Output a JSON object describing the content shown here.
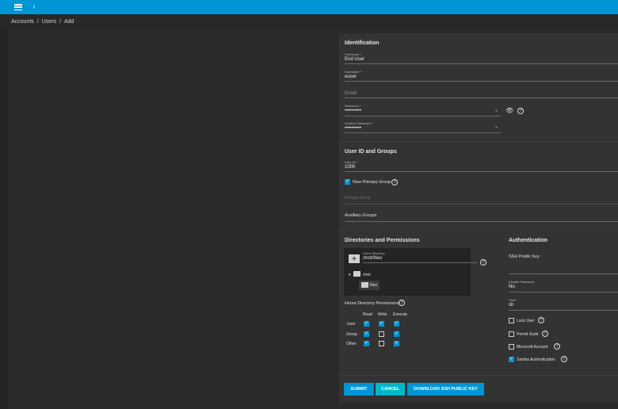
{
  "topbar": {
    "menu_icon": "hamburger-menu-icon",
    "back_icon": "chevron-left-icon"
  },
  "breadcrumb": {
    "items": [
      "Accounts",
      "/",
      "Users",
      "/",
      "Add"
    ]
  },
  "identification": {
    "title": "Identification",
    "full_name": {
      "label": "Full Name *",
      "value": "End User"
    },
    "username": {
      "label": "Username *",
      "value": "euser"
    },
    "email": {
      "placeholder": "Email"
    },
    "password": {
      "label": "Password *",
      "value": "••••••••••"
    },
    "confirm_password": {
      "label": "Confirm Password *",
      "value": "••••••••••"
    }
  },
  "user_id_groups": {
    "title": "User ID and Groups",
    "user_id": {
      "label": "User ID *",
      "value": "1000"
    },
    "new_primary_group": {
      "label": "New Primary Group",
      "checked": true
    },
    "primary_group": {
      "placeholder": "Primary Group"
    },
    "auxiliary_groups": {
      "placeholder": "Auxiliary Groups"
    }
  },
  "directories": {
    "title": "Directories and Permissions",
    "home_directory": {
      "label": "Home Directory",
      "value": "/mnt/Neo"
    },
    "tree": {
      "root": "/mnt",
      "child": "Neo"
    },
    "permissions_title": "Home Directory Permissions",
    "columns": [
      "Read",
      "Write",
      "Execute"
    ],
    "rows": [
      {
        "label": "User",
        "values": [
          true,
          true,
          true
        ]
      },
      {
        "label": "Group",
        "values": [
          true,
          false,
          true
        ]
      },
      {
        "label": "Other",
        "values": [
          true,
          false,
          true
        ]
      }
    ]
  },
  "authentication": {
    "title": "Authentication",
    "ssh_public_key": {
      "placeholder": "SSH Public Key"
    },
    "disable_password": {
      "label": "Disable Password",
      "value": "No"
    },
    "shell": {
      "label": "Shell",
      "value": "sh"
    },
    "lock_user": {
      "label": "Lock User",
      "checked": false
    },
    "permit_sudo": {
      "label": "Permit Sudo",
      "checked": false
    },
    "microsoft_account": {
      "label": "Microsoft Account",
      "checked": false
    },
    "samba_authentication": {
      "label": "Samba Authentication",
      "checked": true
    }
  },
  "actions": {
    "submit": "SUBMIT",
    "cancel": "CANCEL",
    "download_ssh": "DOWNLOAD SSH PUBLIC KEY"
  },
  "colors": {
    "accent": "#0095d5",
    "cancel": "#00b8c9",
    "background": "#1e1e1e",
    "card": "#333333"
  }
}
